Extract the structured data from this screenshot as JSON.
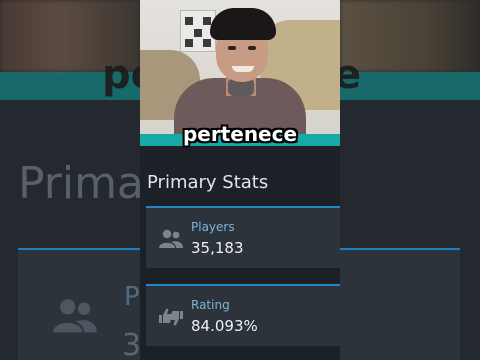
{
  "caption": "pertenece",
  "section_title": "Primary Stats",
  "stats": [
    {
      "label": "Players",
      "value": "35,183",
      "icon": "users-icon"
    },
    {
      "label": "Rating",
      "value": "84.093%",
      "icon": "thumbs-up-down-icon"
    }
  ],
  "background_echo": {
    "caption_fragment_left": "pe",
    "caption_fragment_right": "e",
    "title_fragment": "Primar",
    "stat_initial": "P",
    "stat_value_fragment": "3"
  },
  "colors": {
    "accent": "#1e86c9",
    "teal": "#18a9a6",
    "label": "#7fb4d8",
    "card": "#2c333a",
    "page": "#1c2127"
  }
}
